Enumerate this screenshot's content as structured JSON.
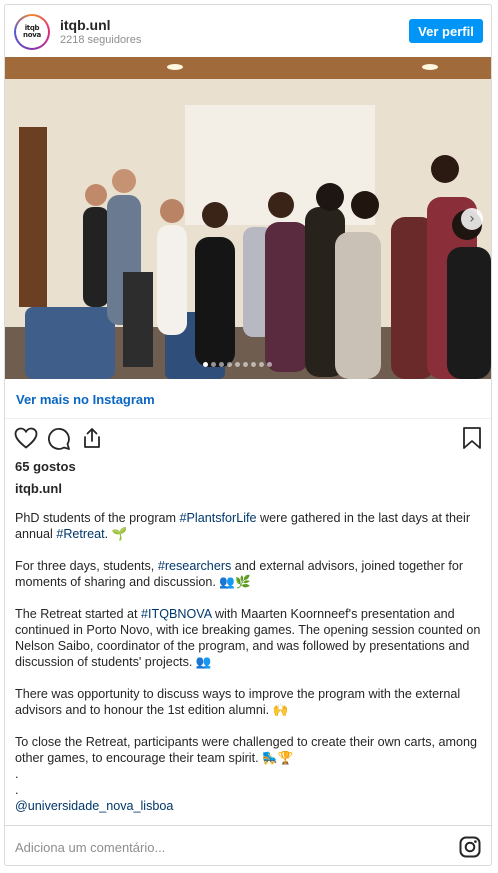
{
  "header": {
    "avatar_text": "itqb\nnova",
    "username": "itqb.unl",
    "followers": "2218 seguidores",
    "profile_button": "Ver perfil"
  },
  "photo": {
    "slide_count": 9,
    "active_slide": 0,
    "icons": {
      "next": "chevron-right-icon"
    }
  },
  "view_more": "Ver mais no Instagram",
  "actions": {
    "icons": [
      "heart-icon",
      "comment-icon",
      "share-icon",
      "bookmark-icon"
    ]
  },
  "likes": "65 gostos",
  "caption": {
    "username": "itqb.unl",
    "p1_a": "PhD students of the program ",
    "p1_tag": "#PlantsforLife",
    "p1_b": " were gathered in the last days at their annual ",
    "p1_tag2": "#Retreat",
    "p1_c": ". 🌱",
    "p2_a": "For three days, students, ",
    "p2_tag": "#researchers",
    "p2_b": " and external advisors, joined together for moments of sharing and discussion. 👥🌿",
    "p3_a": "The Retreat started at ",
    "p3_tag": "#ITQBNOVA",
    "p3_b": " with Maarten Koornneef's presentation and continued in Porto Novo, with ice breaking games. The opening session counted on Nelson Saibo, coordinator of the program, and was followed by presentations and discussion of students' projects. 👥",
    "p4": "There was opportunity to discuss ways to improve the program with the external advisors and to honour the 1st edition alumni. 🙌",
    "p5": "To close the Retreat, participants were challenged to create their own carts, among other games, to encourage their team spirit. 🛼🏆",
    "dot1": ".",
    "dot2": ".",
    "mention": "@universidade_nova_lisboa"
  },
  "comment": {
    "placeholder": "Adiciona um comentário...",
    "icon": "instagram-icon"
  },
  "colors": {
    "accent": "#0095f6",
    "link": "#00376b",
    "muted": "#8e8e8e",
    "border": "#dbdbdb"
  }
}
